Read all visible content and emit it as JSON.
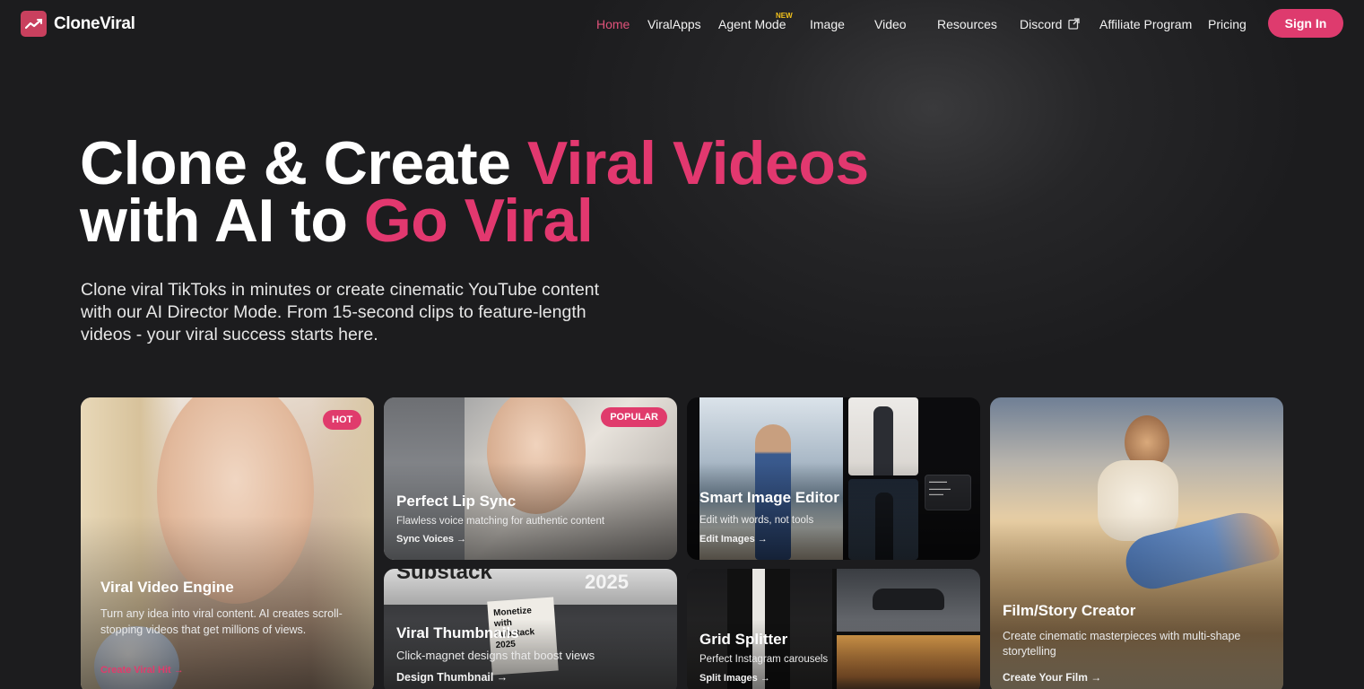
{
  "brand": {
    "name": "CloneViral"
  },
  "nav": {
    "links": [
      {
        "label": "Home",
        "active": true
      },
      {
        "label": "ViralApps"
      },
      {
        "label": "Agent Mode",
        "badge": "NEW"
      },
      {
        "label": "Image"
      },
      {
        "label": "Video"
      },
      {
        "label": "Resources"
      },
      {
        "label": "Discord",
        "external": true
      },
      {
        "label": "Affiliate Program"
      },
      {
        "label": "Pricing"
      }
    ],
    "signin": "Sign In"
  },
  "hero": {
    "line1_white": "Clone & Create ",
    "line1_pink": "Viral Videos",
    "line2_white": "with AI to ",
    "line2_pink": "Go Viral",
    "subtitle": "Clone viral TikToks in minutes or create cinematic YouTube content with our AI Director Mode. From 15-second clips to feature-length videos - your viral success starts here."
  },
  "cards": {
    "viral_video": {
      "badge": "HOT",
      "title": "Viral Video Engine",
      "desc": "Turn any idea into viral content. AI creates scroll-stopping videos that get millions of views.",
      "link": "Create Viral Hit →"
    },
    "lip_sync": {
      "badge": "POPULAR",
      "title": "Perfect Lip Sync",
      "desc": "Flawless voice matching for authentic content",
      "link": "Sync Voices →"
    },
    "image_editor": {
      "title": "Smart Image Editor",
      "desc": "Edit with words, not tools",
      "link": "Edit Images →"
    },
    "film": {
      "title": "Film/Story Creator",
      "desc": "Create cinematic masterpieces with multi-shape storytelling",
      "link": "Create Your Film →"
    },
    "thumbnails": {
      "title": "Viral Thumbnails",
      "desc": "Click-magnet designs that boost views",
      "link": "Design Thumbnail →",
      "sign_text": "Substack",
      "year": "2025",
      "poster": "Monetize with Substack 2025"
    },
    "grid": {
      "title": "Grid Splitter",
      "desc": "Perfect Instagram carousels",
      "link": "Split Images →"
    }
  },
  "colors": {
    "accent": "#e2386f",
    "background": "#1c1c1e",
    "new_badge": "#f3c21b"
  }
}
